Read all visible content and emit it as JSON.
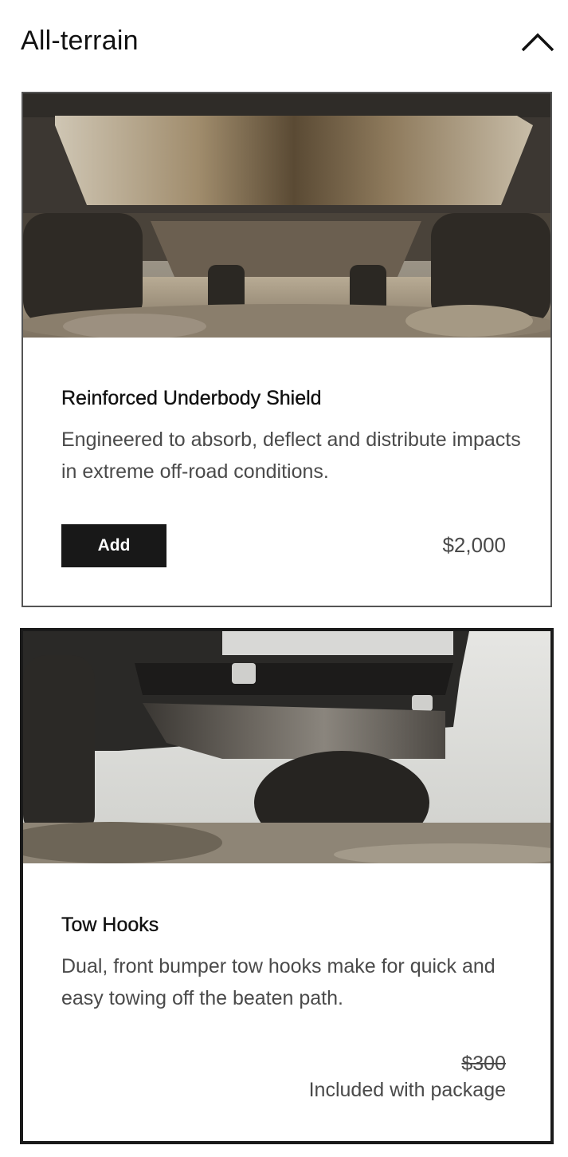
{
  "section": {
    "title": "All-terrain",
    "toggle_icon": "chevron-up-icon"
  },
  "items": [
    {
      "title": "Reinforced Underbody Shield",
      "description": "Engineered to absorb, deflect and distribute impacts in extreme off-road conditions.",
      "add_label": "Add",
      "price": "$2,000",
      "selected": false
    },
    {
      "title": "Tow Hooks",
      "description": "Dual, front bumper tow hooks make for quick and easy towing off the beaten path.",
      "price_original": "$300",
      "price_note": "Included with package",
      "selected": true
    }
  ],
  "colors": {
    "text": "#111111",
    "muted_text": "#4a4a4a",
    "button_bg": "#181818",
    "selected_border": "#1a1a1a",
    "card_border": "#555555"
  }
}
